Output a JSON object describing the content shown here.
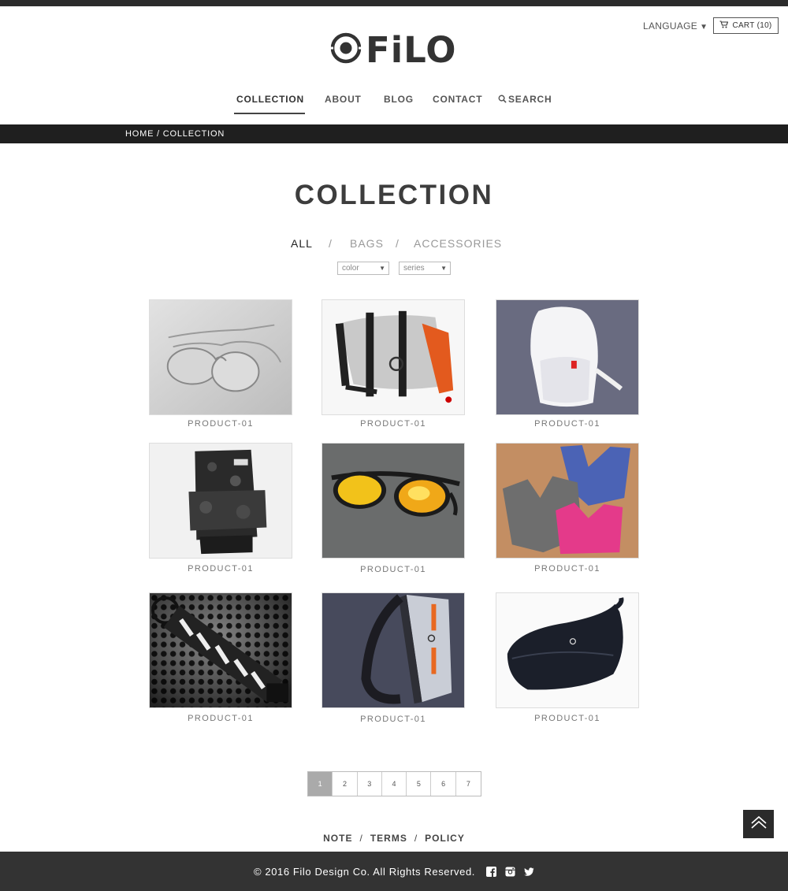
{
  "header": {
    "language_label": "LANGUAGE",
    "language_caret": "▼",
    "cart_label": "CART (10)",
    "logo_text": "FiLO"
  },
  "nav": {
    "items": [
      {
        "label": "COLLECTION",
        "active": true
      },
      {
        "label": "ABOUT"
      },
      {
        "label": "BLOG"
      },
      {
        "label": "CONTACT"
      },
      {
        "label": "SEARCH"
      }
    ]
  },
  "breadcrumb": {
    "home": "HOME",
    "separator": " / ",
    "current": "COLLECTION"
  },
  "page": {
    "title": "COLLECTION"
  },
  "filters": {
    "tabs": [
      {
        "label": "ALL",
        "active": true
      },
      {
        "label": "BAGS"
      },
      {
        "label": "ACCESSORIES"
      }
    ],
    "separator": "/",
    "color_select": {
      "value": "color"
    },
    "series_select": {
      "value": "series"
    }
  },
  "products": [
    {
      "name": "PRODUCT-01",
      "image": "silver-aviator-sunglasses"
    },
    {
      "name": "PRODUCT-01",
      "image": "grey-messenger-bag"
    },
    {
      "name": "PRODUCT-01",
      "image": "white-backpack"
    },
    {
      "name": "PRODUCT-01",
      "image": "black-camo-backpack"
    },
    {
      "name": "PRODUCT-01",
      "image": "yellow-mirror-sunglasses"
    },
    {
      "name": "PRODUCT-01",
      "image": "sports-bras"
    },
    {
      "name": "PRODUCT-01",
      "image": "camera-strap"
    },
    {
      "name": "PRODUCT-01",
      "image": "sling-bag"
    },
    {
      "name": "PRODUCT-01",
      "image": "black-waist-bag"
    }
  ],
  "pagination": {
    "pages": [
      "1",
      "2",
      "3",
      "4",
      "5",
      "6",
      "7"
    ],
    "current": "1"
  },
  "footer": {
    "links": [
      "NOTE",
      "TERMS",
      "POLICY"
    ],
    "separator": "/",
    "copyright": "© 2016 Filo Design Co. All Rights Reserved.",
    "social": [
      "facebook-icon",
      "instagram-icon",
      "twitter-icon"
    ]
  },
  "colors": {
    "topbar": "#2b2b2b",
    "breadcrumb_bg": "#1f1f1f",
    "footer_bg": "#333333",
    "pager_active": "#aaaaaa",
    "filter_inactive": "#999999"
  }
}
